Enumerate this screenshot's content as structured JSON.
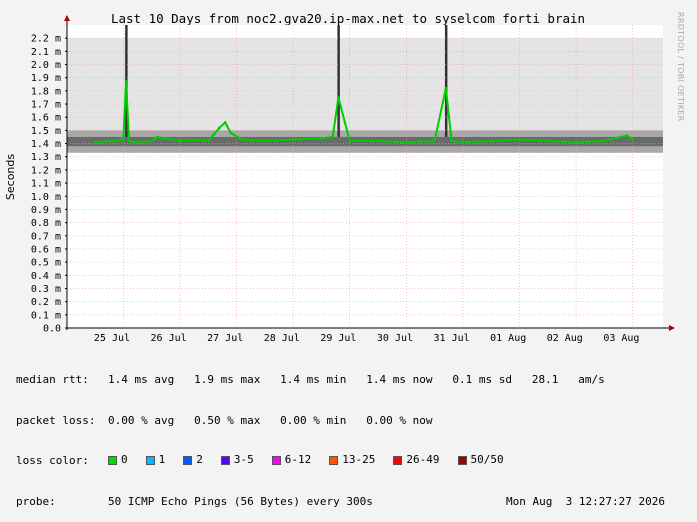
{
  "chart_data": {
    "type": "area",
    "title": "Last 10 Days from noc2.gva20.ip-max.net to syselcom_forti_brain",
    "ylabel": "Seconds",
    "ylim": [
      0,
      0.0023
    ],
    "y_ticks": [
      "0.0",
      "0.1 m",
      "0.2 m",
      "0.3 m",
      "0.4 m",
      "0.5 m",
      "0.6 m",
      "0.7 m",
      "0.8 m",
      "0.9 m",
      "1.0 m",
      "1.1 m",
      "1.2 m",
      "1.3 m",
      "1.4 m",
      "1.5 m",
      "1.6 m",
      "1.7 m",
      "1.8 m",
      "1.9 m",
      "2.0 m",
      "2.1 m",
      "2.2 m"
    ],
    "x_ticks": [
      "25 Jul",
      "26 Jul",
      "27 Jul",
      "28 Jul",
      "29 Jul",
      "30 Jul",
      "31 Jul",
      "01 Aug",
      "02 Aug",
      "03 Aug"
    ],
    "grid": true,
    "series": [
      {
        "name": "median rtt",
        "color": "#00cc00",
        "x_days": [
          0,
          0.3,
          0.5,
          0.55,
          0.6,
          0.7,
          1.0,
          1.1,
          1.5,
          1.8,
          2.0,
          2.1,
          2.2,
          2.3,
          2.4,
          2.6,
          3.0,
          3.5,
          4.0,
          4.2,
          4.3,
          4.5,
          5.0,
          5.5,
          6.0,
          6.2,
          6.3,
          6.5,
          7.0,
          7.5,
          8.0,
          8.5,
          9.0,
          9.4,
          9.5
        ],
        "y_ms": [
          1.41,
          1.42,
          1.43,
          1.87,
          1.42,
          1.41,
          1.42,
          1.45,
          1.42,
          1.43,
          1.42,
          1.47,
          1.52,
          1.56,
          1.48,
          1.43,
          1.42,
          1.43,
          1.44,
          1.45,
          1.75,
          1.42,
          1.42,
          1.41,
          1.42,
          1.82,
          1.42,
          1.41,
          1.42,
          1.43,
          1.42,
          1.41,
          1.42,
          1.46,
          1.43
        ]
      }
    ],
    "loss_legend": [
      {
        "label": "0",
        "color": "#00dd00"
      },
      {
        "label": "1",
        "color": "#00b8ff"
      },
      {
        "label": "2",
        "color": "#0059ff"
      },
      {
        "label": "3-5",
        "color": "#5e00ff"
      },
      {
        "label": "6-12",
        "color": "#ff00ff"
      },
      {
        "label": "13-25",
        "color": "#ff5500"
      },
      {
        "label": "26-49",
        "color": "#ff0000"
      },
      {
        "label": "50/50",
        "color": "#a10000"
      }
    ]
  },
  "stats": {
    "median_label": "median rtt:",
    "median_text": "1.4 ms avg   1.9 ms max   1.4 ms min   1.4 ms now   0.1 ms sd   28.1   am/s",
    "loss_label": "packet loss:",
    "loss_text": "0.00 % avg   0.50 % max   0.00 % min   0.00 % now",
    "color_label": "loss color:",
    "probe_label": "probe:",
    "probe_text": "50 ICMP Echo Pings (56 Bytes) every 300s",
    "date_text": "Mon Aug  3 12:27:27 2026"
  },
  "watermark": "RRDTOOL / TOBI OETIKER"
}
